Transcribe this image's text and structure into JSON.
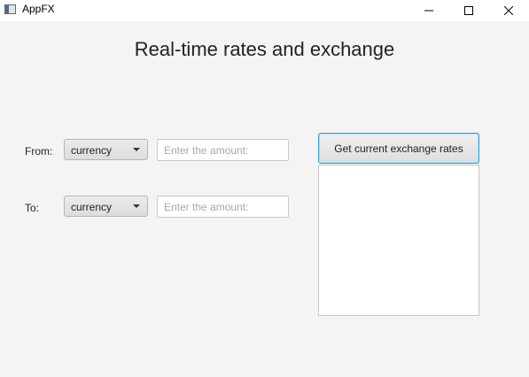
{
  "window": {
    "title": "AppFX"
  },
  "main": {
    "heading": "Real-time rates and exchange"
  },
  "from_row": {
    "label": "From:",
    "currency_value": "currency",
    "amount_placeholder": "Enter the amount:",
    "amount_value": ""
  },
  "to_row": {
    "label": "To:",
    "currency_value": "currency",
    "amount_placeholder": "Enter the amount:",
    "amount_value": ""
  },
  "rates": {
    "button_label": "Get current exchange rates",
    "output_text": ""
  },
  "icons": {
    "app": "app-window-icon",
    "minimize": "minimize-icon",
    "maximize": "maximize-icon",
    "close": "close-icon",
    "dropdown": "chevron-down-icon"
  },
  "colors": {
    "background": "#f4f4f4",
    "focus_accent": "#3d9ad8"
  }
}
